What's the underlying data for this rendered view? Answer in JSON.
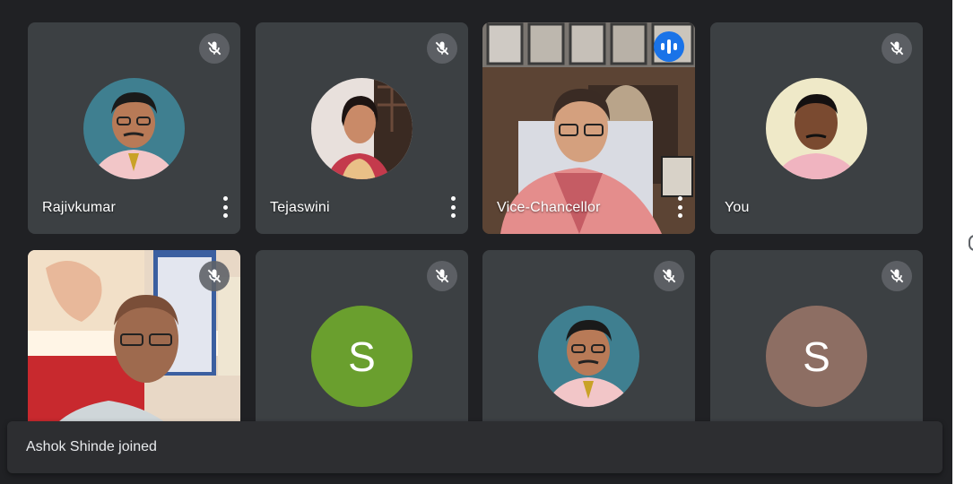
{
  "participants": [
    {
      "name": "Rajivkumar",
      "muted": true
    },
    {
      "name": "Tejaswini",
      "muted": true
    },
    {
      "name": "Vice-Chancellor",
      "muted": false,
      "speaking": true
    },
    {
      "name": "You",
      "muted": true
    },
    {
      "name": "",
      "muted": true
    },
    {
      "name": "",
      "muted": true,
      "initial": "S",
      "avatar_color": "#6a9f2e"
    },
    {
      "name": "",
      "muted": true
    },
    {
      "name": "",
      "muted": true,
      "initial": "S",
      "avatar_color": "#8d6e63"
    }
  ],
  "notification": {
    "text": "Ashok Shinde joined"
  }
}
